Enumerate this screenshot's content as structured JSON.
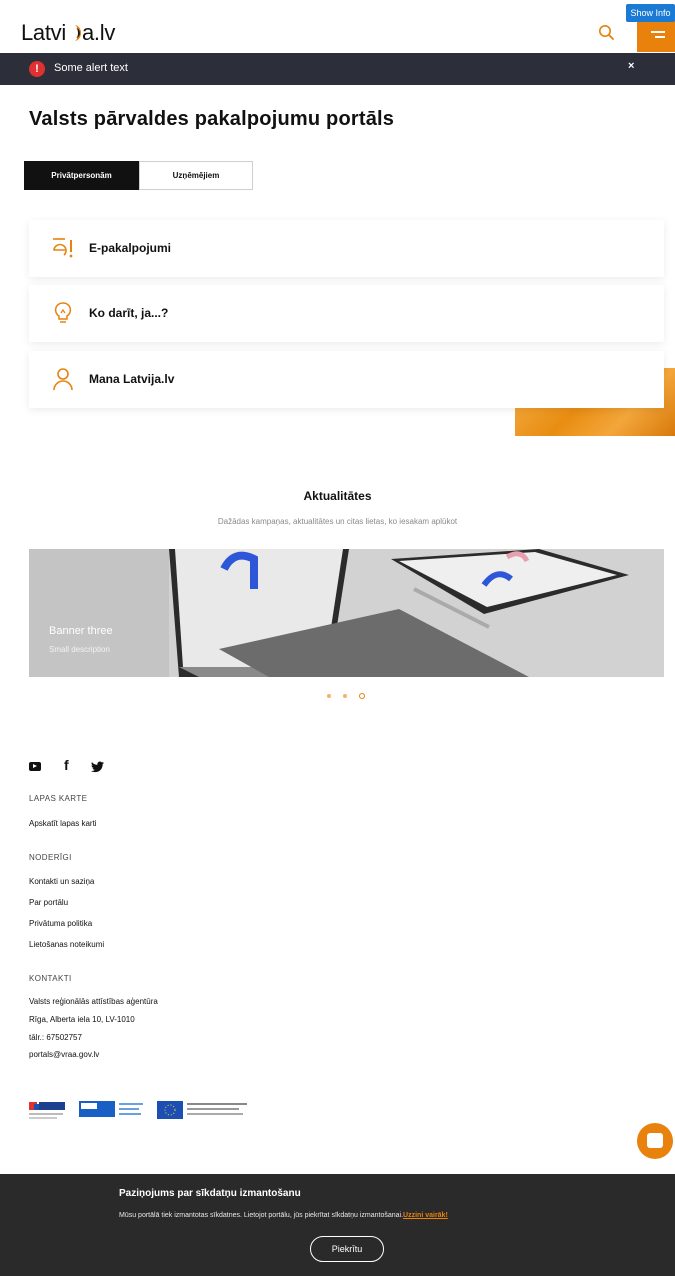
{
  "header": {
    "logo_text_a": "Latvi",
    "logo_text_b": "a.lv",
    "show_info": "Show Info"
  },
  "alert": {
    "text": "Some alert text",
    "close": "×",
    "icon": "warning-icon"
  },
  "main": {
    "title": "Valsts pārvaldes pakalpojumu portāls",
    "tabs": [
      {
        "label": "Privātpersonām",
        "active": true
      },
      {
        "label": "Uzņēmējiem",
        "active": false
      }
    ],
    "cards": [
      {
        "label": "E-pakalpojumi",
        "icon": "e-services-icon"
      },
      {
        "label": "Ko darīt, ja...?",
        "icon": "lightbulb-icon"
      },
      {
        "label": "Mana Latvija.lv",
        "icon": "user-icon"
      }
    ]
  },
  "news": {
    "title": "Aktualitātes",
    "subtitle": "Dažādas kampaņas, aktualitātes un citas lietas, ko iesakam aplūkot",
    "banner_title": "Banner three",
    "banner_desc": "Small description",
    "active_slide": 3,
    "slide_count": 3
  },
  "footer": {
    "sections": [
      {
        "heading": "LAPAS KARTE",
        "links": [
          "Apskatīt lapas karti"
        ]
      },
      {
        "heading": "NODERĪGI",
        "links": [
          "Kontakti un saziņa",
          "Par portālu",
          "Privātuma politika",
          "Lietošanas noteikumi"
        ]
      },
      {
        "heading": "KONTAKTI",
        "links": [
          "Valsts reģionālās attīstības aģentūra",
          "Rīga, Alberta iela 10, LV-1010",
          "tālr.: 67502757",
          "portals@vraa.gov.lv"
        ]
      }
    ]
  },
  "cookie": {
    "title": "Paziņojums par sīkdatņu izmantošanu",
    "text": "Mūsu portālā tiek izmantotas sīkdatnes. Lietojot portālu, jūs piekrītat sīkdatņu izmantošanai.",
    "link": "Uzzini vairāk!",
    "button": "Piekrītu"
  },
  "colors": {
    "accent": "#e8820c",
    "alert_bg": "#2c2f3a",
    "cookie_bg": "#2a2a2a"
  }
}
